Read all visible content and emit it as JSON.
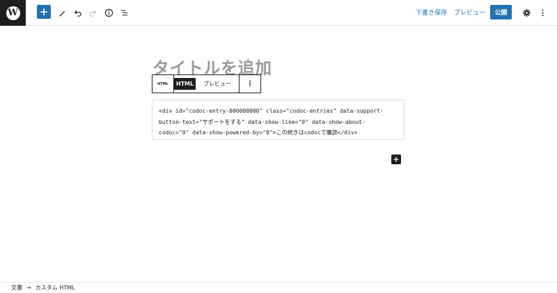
{
  "header": {
    "logo_letter": "W",
    "save_draft": "下書き保存",
    "preview": "プレビュー",
    "publish": "公開"
  },
  "post": {
    "title_placeholder": "タイトルを追加"
  },
  "block_toolbar": {
    "block_icon_label": "HTML",
    "html_tab": "HTML",
    "preview_tab": "プレビュー",
    "more": "⋮"
  },
  "code_block": {
    "lines": [
      "<div id=\"codoc-entry-000000000\" class=\"codoc-entries\" data-support-",
      "button-text=\"サポートをする\" data-show-like=\"0\" data-show-about-",
      "codoc=\"0\" data-show-powered-by=\"0\">この続きはcodocで購読</div>"
    ]
  },
  "footer": {
    "crumb_document": "文書",
    "arrow": "→",
    "crumb_block": "カスタム HTML"
  },
  "colors": {
    "accent": "#2271b1",
    "dark": "#1e1e1e"
  }
}
